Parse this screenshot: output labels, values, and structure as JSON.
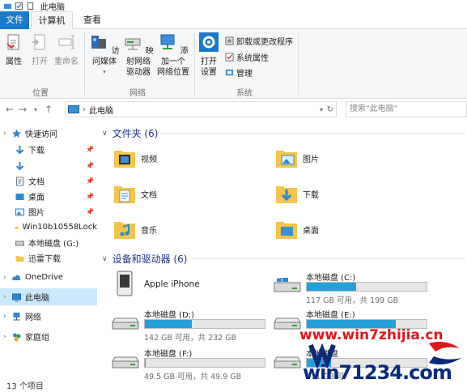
{
  "window": {
    "title": "此电脑"
  },
  "tabs": [
    {
      "label": "文件"
    },
    {
      "label": "计算机"
    },
    {
      "label": "查看"
    }
  ],
  "ribbon": {
    "location": {
      "properties": "属性",
      "open": "打开",
      "rename": "重命名",
      "group": "位置"
    },
    "network": {
      "access_media": "访问媒体",
      "map_drive_1": "映射网络",
      "map_drive_2": "驱动器",
      "add_location_1": "添加一个",
      "add_location_2": "网络位置",
      "group": "网络"
    },
    "system": {
      "open_settings_1": "打开",
      "open_settings_2": "设置",
      "uninstall": "卸载或更改程序",
      "sys_props": "系统属性",
      "manage": "管理",
      "group": "系统"
    }
  },
  "address": {
    "path": "此电脑",
    "search_placeholder": "搜索\"此电脑\""
  },
  "nav": {
    "quick_access": "快速访问",
    "items": [
      {
        "label": "下载"
      },
      {
        "label": ""
      },
      {
        "label": "文档"
      },
      {
        "label": "桌面"
      },
      {
        "label": "图片"
      },
      {
        "label": "Win10b10558Lock"
      },
      {
        "label": "本地磁盘 (G:)"
      },
      {
        "label": "迅雷下载"
      }
    ],
    "onedrive": "OneDrive",
    "this_pc": "此电脑",
    "network": "网络",
    "homegroup": "家庭组"
  },
  "folders_section": {
    "title": "文件夹 (6)"
  },
  "folders": [
    {
      "name": "视频"
    },
    {
      "name": "图片"
    },
    {
      "name": "文档"
    },
    {
      "name": "下载"
    },
    {
      "name": "音乐"
    },
    {
      "name": "桌面"
    }
  ],
  "devices_section": {
    "title": "设备和驱动器 (6)"
  },
  "devices": [
    {
      "name": "Apple iPhone"
    },
    {
      "name": "本地磁盘 (C:)",
      "size": "117 GB 可用，共 199 GB",
      "used_fraction": 0.41
    },
    {
      "name": "本地磁盘 (D:)",
      "size": "142 GB 可用，共 232 GB",
      "used_fraction": 0.39
    },
    {
      "name": "本地磁盘 (E:)",
      "size": "",
      "used_fraction": 0.74
    },
    {
      "name": "本地磁盘 (F:)",
      "size": "49.5 GB 可用，共 49.9 GB",
      "used_fraction": 0.01
    },
    {
      "name": "本地磁盘",
      "size": "271 GB 可",
      "used_fraction": 0.2
    }
  ],
  "status": {
    "count": "13 个项目"
  },
  "watermark": {
    "line1": "www.win7zhijia.cn",
    "line2": "win71234.com"
  },
  "colors": {
    "accent": "#1979ca",
    "drive_fill": "#26a0da",
    "selected": "#cce8ff"
  }
}
